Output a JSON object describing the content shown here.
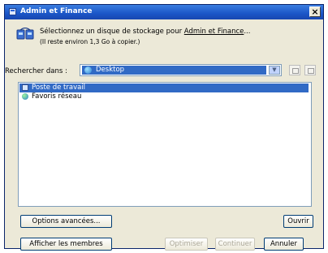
{
  "window": {
    "title": "Admin et Finance",
    "close_label": "×"
  },
  "header": {
    "prompt_prefix": "Sélectionnez un disque de stockage pour ",
    "prompt_link": "Admin et Finance",
    "prompt_suffix": "...",
    "subtext": "(Il reste environ 1,3 Go à copier.)"
  },
  "lookin": {
    "label": "Rechercher dans :",
    "value": "Desktop"
  },
  "list": {
    "items": [
      {
        "label": "Poste de travail",
        "selected": true
      },
      {
        "label": "Favoris réseau",
        "selected": false
      }
    ]
  },
  "buttons": {
    "options": "Options avancées...",
    "open": "Ouvrir",
    "members": "Afficher les membres",
    "optimize": "Optimiser",
    "continue": "Continuer",
    "cancel": "Annuler"
  },
  "colors": {
    "titlebar": "#1b56c7",
    "selection": "#316ac5",
    "dialog_bg": "#ece9d8"
  }
}
